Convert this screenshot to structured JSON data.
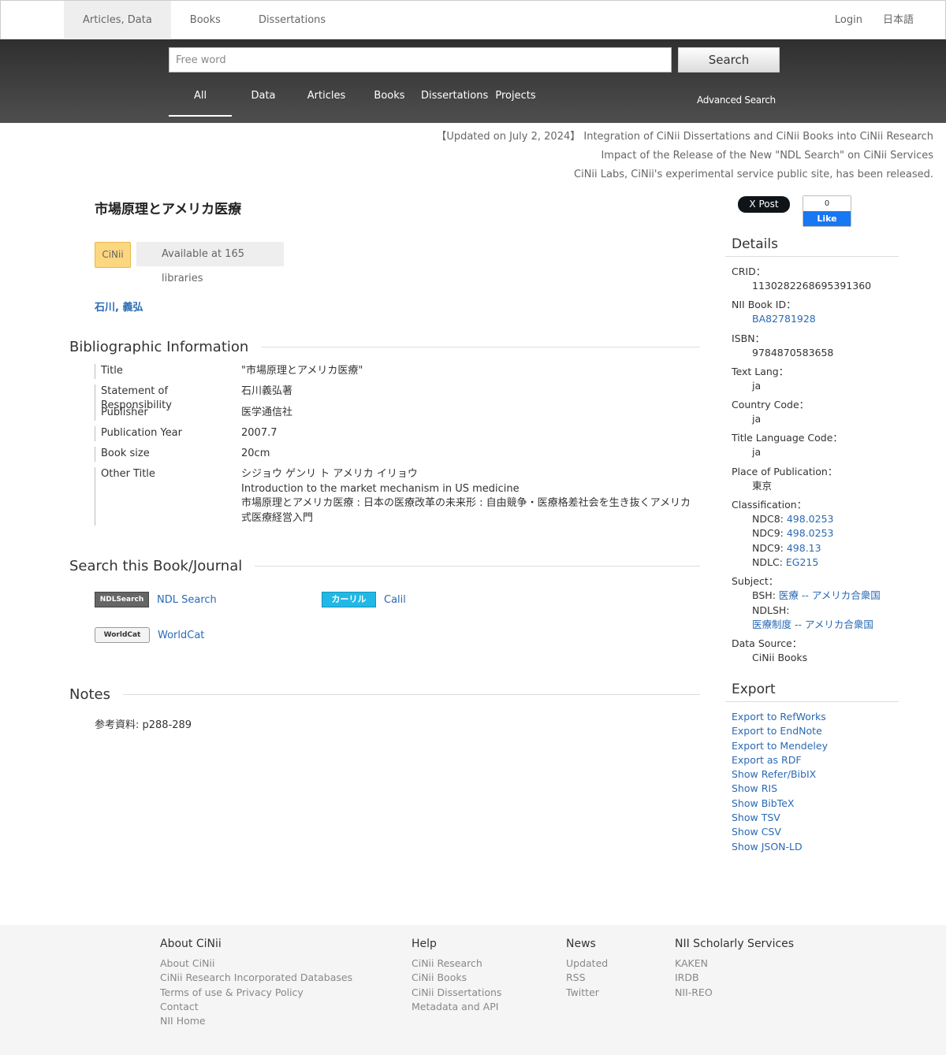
{
  "topnav": {
    "tabs": [
      "Articles, Data",
      "Books",
      "Dissertations"
    ],
    "login": "Login",
    "language": "日本語"
  },
  "search": {
    "placeholder": "Free word",
    "button": "Search",
    "tabs": [
      "All",
      "Data",
      "Articles",
      "Books",
      "Dissertations",
      "Projects"
    ],
    "advanced": "Advanced Search"
  },
  "notices": [
    "【Updated on July 2, 2024】 Integration of CiNii Dissertations and CiNii Books into CiNii Research",
    "Impact of the Release of the New \"NDL Search\" on CiNii Services",
    "CiNii Labs, CiNii's experimental service public site, has been released."
  ],
  "book": {
    "title": "市場原理とアメリカ医療",
    "badge": "CiNii",
    "availability": "Available at 165 libraries",
    "author": "石川, 義弘"
  },
  "bibliographic": {
    "heading": "Bibliographic Information",
    "rows": [
      {
        "label": "Title",
        "value": "\"市場原理とアメリカ医療\""
      },
      {
        "label": "Statement of Responsibility",
        "value": "石川義弘著"
      },
      {
        "label": "Publisher",
        "value": "医学通信社"
      },
      {
        "label": "Publication Year",
        "value": "2007.7"
      },
      {
        "label": "Book size",
        "value": "20cm"
      },
      {
        "label": "Other Title",
        "values": [
          "シジョウ ゲンリ ト アメリカ イリョウ",
          "Introduction to the market mechanism in US medicine",
          "市場原理とアメリカ医療 : 日本の医療改革の未来形 : 自由競争・医療格差社会を生き抜くアメリカ式医療経営入門"
        ]
      }
    ]
  },
  "search_journal": {
    "heading": "Search this Book/Journal",
    "ndl_logo": "NDLSearch",
    "ndl": "NDL Search",
    "calil_logo": "カーリル",
    "calil": "Calil",
    "worldcat_logo": "WorldCat",
    "worldcat": "WorldCat"
  },
  "notes": {
    "heading": "Notes",
    "text": "参考資料: p288-289"
  },
  "social": {
    "xpost": "X Post",
    "fb_count": "0",
    "fb_like": "Like"
  },
  "details": {
    "heading": "Details",
    "crid_label": "CRID：",
    "crid": "1130282268695391360",
    "nii_label": "NII Book ID：",
    "nii": "BA82781928",
    "isbn_label": "ISBN：",
    "isbn": "9784870583658",
    "textlang_label": "Text Lang：",
    "textlang": "ja",
    "country_label": "Country Code：",
    "country": "ja",
    "titlelang_label": "Title Language Code：",
    "titlelang": "ja",
    "place_label": "Place of Publication：",
    "place": "東京",
    "class_label": "Classification：",
    "class": [
      {
        "k": "NDC8: ",
        "v": "498.0253"
      },
      {
        "k": "NDC9: ",
        "v": "498.0253"
      },
      {
        "k": "NDC9: ",
        "v": "498.13"
      },
      {
        "k": "NDLC: ",
        "v": "EG215"
      }
    ],
    "subject_label": "Subject：",
    "bsh_label": "BSH: ",
    "bsh": "医療 -- アメリカ合衆国",
    "ndlsh_label": "NDLSH:",
    "ndlsh": "医療制度 -- アメリカ合衆国",
    "source_label": "Data Source：",
    "source": "CiNii Books"
  },
  "export": {
    "heading": "Export",
    "items": [
      "Export to RefWorks",
      "Export to EndNote",
      "Export to Mendeley",
      "Export as RDF",
      "Show Refer/BibIX",
      "Show RIS",
      "Show BibTeX",
      "Show TSV",
      "Show CSV",
      "Show JSON-LD"
    ]
  },
  "footer": {
    "about": {
      "heading": "About CiNii",
      "links": [
        "About CiNii",
        "CiNii Research Incorporated Databases",
        "Terms of use & Privacy Policy",
        "Contact",
        "NII Home"
      ]
    },
    "help": {
      "heading": "Help",
      "links": [
        "CiNii Research",
        "CiNii Books",
        "CiNii Dissertations",
        "Metadata and API"
      ]
    },
    "news": {
      "heading": "News",
      "links": [
        "Updated",
        "RSS",
        "Twitter"
      ]
    },
    "nii": {
      "heading": "NII Scholarly Services",
      "links": [
        "KAKEN",
        "IRDB",
        "NII-REO"
      ]
    }
  }
}
